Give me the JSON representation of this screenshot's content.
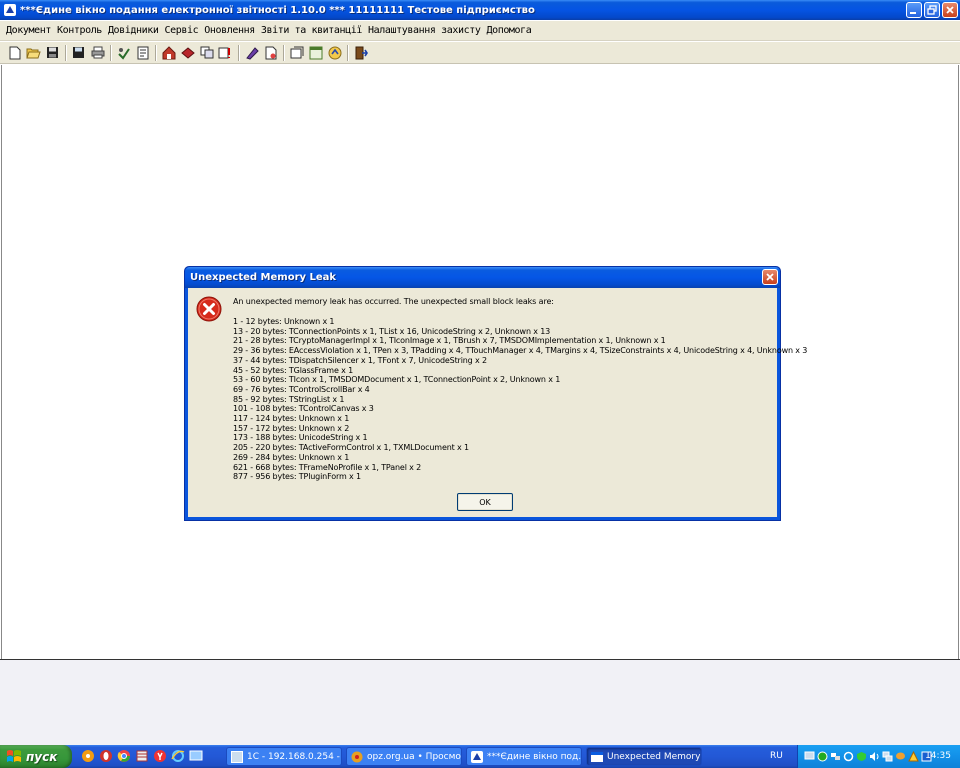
{
  "window": {
    "title": "***Єдине вікно подання електронної звітності 1.10.0 *** 11111111 Тестове підприємство"
  },
  "menu": [
    "Документ",
    "Контроль",
    "Довідники",
    "Сервіс",
    "Оновлення",
    "Звіти та квитанції",
    "Налаштування захисту",
    "Допомога"
  ],
  "toolbar_icons": [
    "new-document-icon",
    "open-folder-icon",
    "save-icon",
    "save-all-icon",
    "print-icon",
    "check-icon",
    "report-icon",
    "home-icon",
    "book-icon",
    "copy-icon",
    "export-icon",
    "sign-icon",
    "new-page-icon",
    "settings-icon",
    "window-icon",
    "help-icon",
    "exit-icon"
  ],
  "dialog": {
    "title": "Unexpected Memory Leak",
    "message": "An unexpected memory leak has occurred. The unexpected small block leaks are:",
    "leaks": [
      "1 - 12 bytes: Unknown x 1",
      "13 - 20 bytes: TConnectionPoints x 1, TList x 16, UnicodeString x 2, Unknown x 13",
      "21 - 28 bytes: TCryptoManagerImpl x 1, TIconImage x 1, TBrush x 7, TMSDOMImplementation x 1, Unknown x 1",
      "29 - 36 bytes: EAccessViolation x 1, TPen x 3, TPadding x 4, TTouchManager x 4, TMargins x 4, TSizeConstraints x 4, UnicodeString x 4, Unknown x 3",
      "37 - 44 bytes: TDispatchSilencer x 1, TFont x 7, UnicodeString x 2",
      "45 - 52 bytes: TGlassFrame x 1",
      "53 - 60 bytes: TIcon x 1, TMSDOMDocument x 1, TConnectionPoint x 2, Unknown x 1",
      "69 - 76 bytes: TControlScrollBar x 4",
      "85 - 92 bytes: TStringList x 1",
      "101 - 108 bytes: TControlCanvas x 3",
      "117 - 124 bytes: Unknown x 1",
      "157 - 172 bytes: Unknown x 2",
      "173 - 188 bytes: UnicodeString x 1",
      "205 - 220 bytes: TActiveFormControl x 1, TXMLDocument x 1",
      "269 - 284 bytes: Unknown x 1",
      "621 - 668 bytes: TFrameNoProfile x 1, TPanel x 2",
      "877 - 956 bytes: TPluginForm x 1"
    ],
    "ok_label": "OK"
  },
  "taskbar": {
    "start_label": "пуск",
    "tasks": [
      {
        "label": "1C - 192.168.0.254 - ...",
        "active": false
      },
      {
        "label": "opz.org.ua • Просмо...",
        "active": false
      },
      {
        "label": "***Єдине вікно под...",
        "active": false
      },
      {
        "label": "Unexpected Memory ...",
        "active": true
      }
    ],
    "language": "RU",
    "clock": "14:35"
  },
  "colors": {
    "xp_blue": "#0554e3",
    "dialog_face": "#ece9d8",
    "error_red": "#d62a1b",
    "start_green": "#36963a",
    "tray_blue": "#1290e8"
  }
}
